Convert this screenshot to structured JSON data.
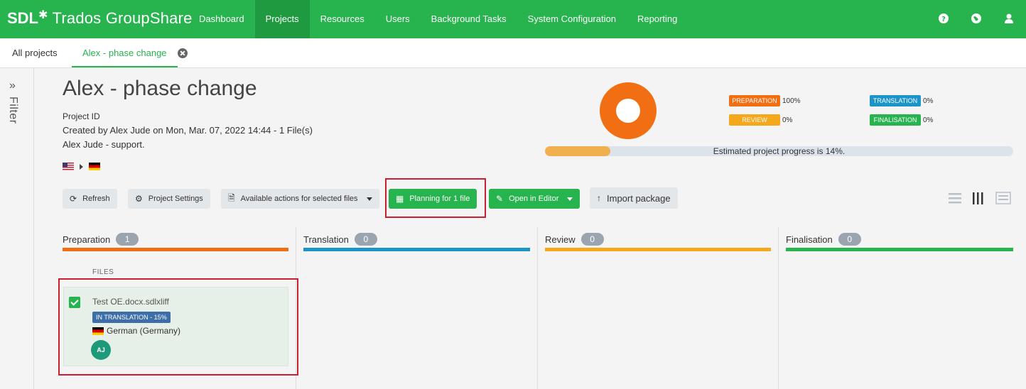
{
  "app": {
    "brand": "SDL",
    "product": "Trados GroupShare"
  },
  "nav": {
    "items": [
      "Dashboard",
      "Projects",
      "Resources",
      "Users",
      "Background Tasks",
      "System Configuration",
      "Reporting"
    ],
    "active": "Projects"
  },
  "header_icons": [
    "help-icon",
    "globe-icon",
    "user-icon"
  ],
  "tabs": {
    "all": "All projects",
    "current": "Alex - phase change"
  },
  "sidebar": {
    "label": "Filter"
  },
  "project": {
    "title": "Alex - phase change",
    "id_label": "Project ID",
    "created": "Created by Alex Jude on Mon, Mar. 07, 2022 14:44 - 1 File(s)",
    "description": "Alex Jude - support.",
    "source_lang": "en-US",
    "target_lang": "de-DE"
  },
  "phases_legend": [
    {
      "label": "PREPARATION",
      "value": "100%",
      "color": "#f26e12"
    },
    {
      "label": "TRANSLATION",
      "value": "0%",
      "color": "#1b94c9"
    },
    {
      "label": "REVIEW",
      "value": "0%",
      "color": "#f6a81c"
    },
    {
      "label": "FINALISATION",
      "value": "0%",
      "color": "#27b34d"
    }
  ],
  "progress": {
    "percent": 14,
    "text": "Estimated project progress is 14%."
  },
  "toolbar": {
    "refresh": "Refresh",
    "settings": "Project Settings",
    "actions": "Available actions for selected files",
    "planning": "Planning for 1 file",
    "open_editor": "Open in Editor",
    "import": "Import package"
  },
  "columns": [
    {
      "name": "Preparation",
      "count": "1",
      "color": "#f26e12"
    },
    {
      "name": "Translation",
      "count": "0",
      "color": "#1b94c9"
    },
    {
      "name": "Review",
      "count": "0",
      "color": "#f6a81c"
    },
    {
      "name": "Finalisation",
      "count": "0",
      "color": "#27b34d"
    }
  ],
  "files": {
    "label": "FILES",
    "items": [
      {
        "name": "Test OE.docx.sdlxliff",
        "status": "IN TRANSLATION - 15%",
        "language": "German (Germany)",
        "assignee": "AJ"
      }
    ]
  }
}
